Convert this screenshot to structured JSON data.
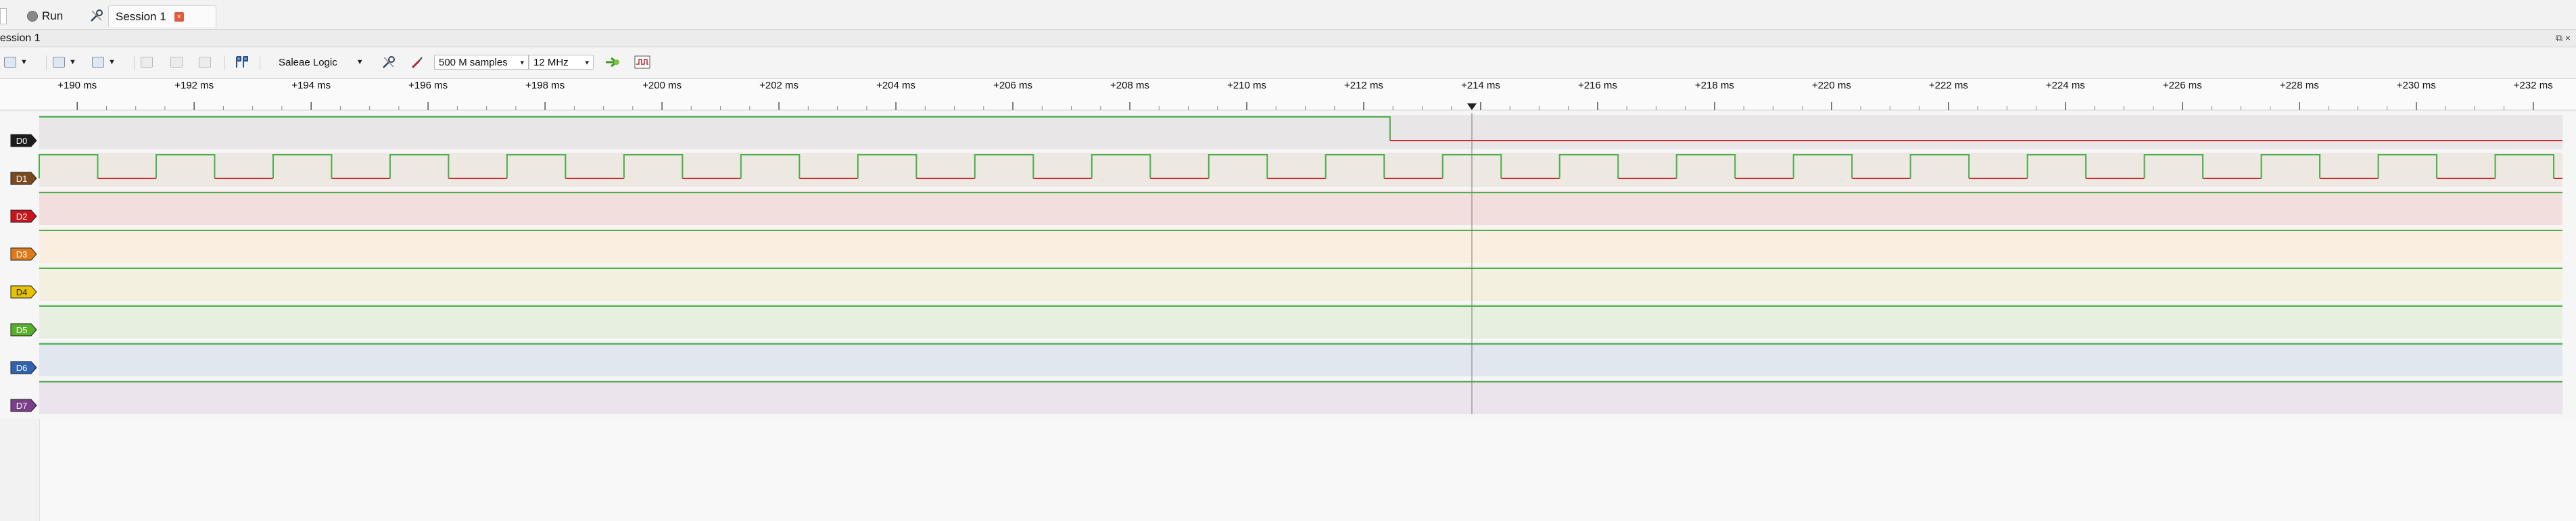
{
  "menubar": {
    "run_label": "Run",
    "session_tab_label": "Session 1",
    "session_close_glyph": "×"
  },
  "session_header": {
    "label": "ession 1",
    "window_controls": "⧉ ×"
  },
  "toolbar": {
    "device": "Saleae Logic",
    "samples": "500 M samples",
    "rate": "12 MHz"
  },
  "timeline": {
    "unit": "ms",
    "ticks": [
      "+190 ms",
      "+192 ms",
      "+194 ms",
      "+196 ms",
      "+198 ms",
      "+200 ms",
      "+202 ms",
      "+204 ms",
      "+206 ms",
      "+208 ms",
      "+210 ms",
      "+212 ms",
      "+214 ms",
      "+216 ms",
      "+218 ms",
      "+220 ms",
      "+222 ms",
      "+224 ms",
      "+226 ms",
      "+228 ms",
      "+230 ms",
      "+232 ms"
    ],
    "start_ms": 189.35,
    "end_ms": 232.5,
    "cursor_ms": 213.85
  },
  "channels": [
    {
      "name": "D0",
      "tag_color": "#1c1c1c",
      "band": "#e8e6e6",
      "kind": "step",
      "high_until_ms": 212.45,
      "high_color": "#4cae4c",
      "low_color": "#d9262e"
    },
    {
      "name": "D1",
      "tag_color": "#7a4a1e",
      "band": "#ede8e1",
      "kind": "clock",
      "period_ms": 2.0,
      "first_rise_ms": 189.35,
      "high_ms": 1.0
    },
    {
      "name": "D2",
      "tag_color": "#c8141c",
      "band": "#f3dede",
      "kind": "high"
    },
    {
      "name": "D3",
      "tag_color": "#e07a18",
      "band": "#faeee0",
      "kind": "high"
    },
    {
      "name": "D4",
      "tag_color": "#e6c200",
      "band": "#f4f0e0",
      "kind": "high"
    },
    {
      "name": "D5",
      "tag_color": "#58b02a",
      "band": "#e6efe0",
      "kind": "high"
    },
    {
      "name": "D6",
      "tag_color": "#2f63b0",
      "band": "#e1e7ef",
      "kind": "high"
    },
    {
      "name": "D7",
      "tag_color": "#7a3f88",
      "band": "#ebe4ec",
      "kind": "high"
    }
  ],
  "colors": {
    "high": "#4cae4c",
    "low": "#d9262e",
    "cursor": "#7a7a7a"
  }
}
